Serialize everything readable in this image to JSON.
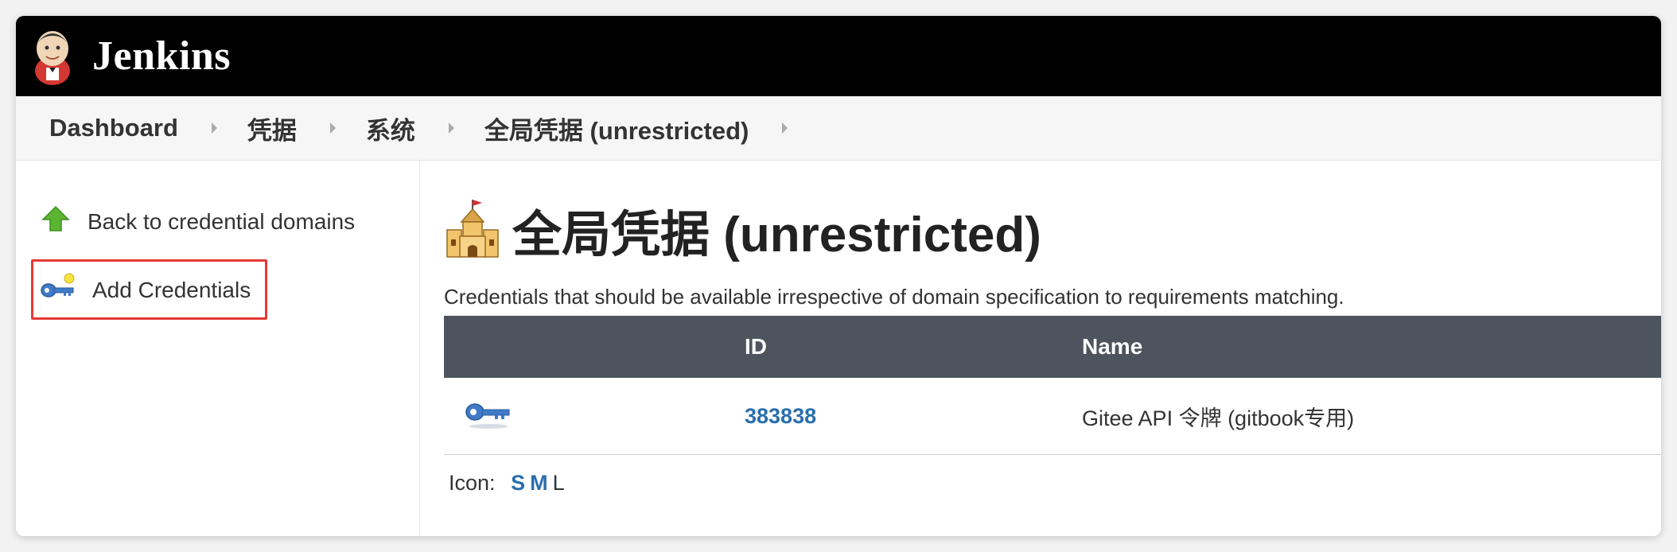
{
  "app": {
    "brand": "Jenkins"
  },
  "breadcrumb": [
    "Dashboard",
    "凭据",
    "系统",
    "全局凭据 (unrestricted)"
  ],
  "sidebar": {
    "back_label": "Back to credential domains",
    "add_label": "Add Credentials"
  },
  "page": {
    "title": "全局凭据 (unrestricted)",
    "description": "Credentials that should be available irrespective of domain specification to requirements matching."
  },
  "table": {
    "headers": [
      "",
      "ID",
      "Name"
    ],
    "rows": [
      {
        "icon": "key-icon",
        "id": "383838",
        "name": "Gitee API 令牌 (gitbook专用)"
      }
    ]
  },
  "icon_size": {
    "label": "Icon:",
    "options": [
      "S",
      "M",
      "L"
    ]
  },
  "colors": {
    "header_bg": "#000000",
    "table_header_bg": "#4d545d",
    "link": "#2a6ead",
    "highlight": "#e53935"
  }
}
